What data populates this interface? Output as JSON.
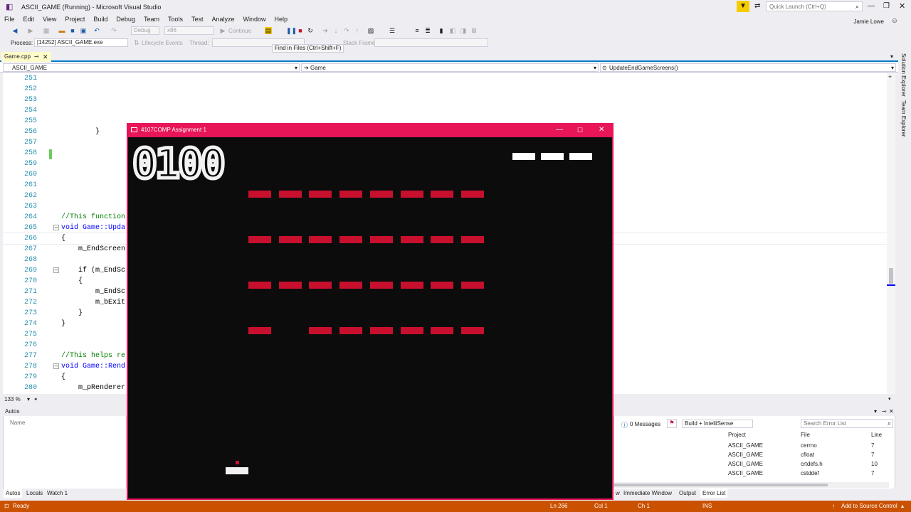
{
  "window": {
    "title": "ASCII_GAME (Running) - Microsoft Visual Studio",
    "quick_launch_placeholder": "Quick Launch (Ctrl+Q)",
    "user": "Jamie Lowe"
  },
  "menu": [
    "File",
    "Edit",
    "View",
    "Project",
    "Build",
    "Debug",
    "Team",
    "Tools",
    "Test",
    "Analyze",
    "Window",
    "Help"
  ],
  "toolbar": {
    "config": "Debug",
    "platform": "x86",
    "continue_label": "Continue",
    "process_label": "Process:",
    "process_value": "[14252] ASCII_GAME.exe",
    "lifecycle_label": "Lifecycle Events",
    "thread_label": "Thread:",
    "stack_frame_label": "Stack Frame:"
  },
  "tooltip": "Find in Files (Ctrl+Shift+F)",
  "doc_tab": "Game.cpp",
  "nav": {
    "project": "ASCII_GAME",
    "scope": "Game",
    "member": "UpdateEndGameScreens()"
  },
  "code_lines": [
    {
      "n": "251",
      "t": ""
    },
    {
      "n": "252",
      "t": ""
    },
    {
      "n": "253",
      "t": ""
    },
    {
      "n": "254",
      "t": ""
    },
    {
      "n": "255",
      "t": ""
    },
    {
      "n": "256",
      "t": "        }"
    },
    {
      "n": "257",
      "t": ""
    },
    {
      "n": "258",
      "t": ""
    },
    {
      "n": "259",
      "t": ""
    },
    {
      "n": "260",
      "t": ""
    },
    {
      "n": "261",
      "t": ""
    },
    {
      "n": "262",
      "t": ""
    },
    {
      "n": "263",
      "t": ""
    },
    {
      "n": "264",
      "t": "//This function"
    },
    {
      "n": "265",
      "t": "void Game::Upda"
    },
    {
      "n": "266",
      "t": "{"
    },
    {
      "n": "267",
      "t": "    m_EndScreen"
    },
    {
      "n": "268",
      "t": ""
    },
    {
      "n": "269",
      "t": "    if (m_EndSc"
    },
    {
      "n": "270",
      "t": "    {"
    },
    {
      "n": "271",
      "t": "        m_EndSc"
    },
    {
      "n": "272",
      "t": "        m_bExit"
    },
    {
      "n": "273",
      "t": "    }"
    },
    {
      "n": "274",
      "t": "}"
    },
    {
      "n": "275",
      "t": ""
    },
    {
      "n": "276",
      "t": ""
    },
    {
      "n": "277",
      "t": "//This helps re"
    },
    {
      "n": "278",
      "t": "void Game::Rend"
    },
    {
      "n": "279",
      "t": "{"
    },
    {
      "n": "280",
      "t": "    m_pRenderer"
    }
  ],
  "zoom": "133 %",
  "autos": {
    "title": "Autos",
    "name_col": "Name"
  },
  "error_list": {
    "messages": "0 Messages",
    "filter": "Build + IntelliSense",
    "search_placeholder": "Search Error List",
    "col_project": "Project",
    "col_file": "File",
    "col_line": "Line",
    "rows": [
      {
        "project": "ASCII_GAME",
        "file": "cerrno",
        "line": "7"
      },
      {
        "project": "ASCII_GAME",
        "file": "cfloat",
        "line": "7"
      },
      {
        "project": "ASCII_GAME",
        "file": "crtdefs.h",
        "line": "10"
      },
      {
        "project": "ASCII_GAME",
        "file": "cstddef",
        "line": "7"
      }
    ]
  },
  "bottom_tabs_left": [
    "Autos",
    "Locals",
    "Watch 1"
  ],
  "bottom_tabs_right": [
    "w",
    "Immediate Window",
    "Output",
    "Error List"
  ],
  "side_tabs": [
    "Solution Explorer",
    "Team Explorer"
  ],
  "status": {
    "ready": "Ready",
    "ln": "Ln 266",
    "col": "Col 1",
    "ch": "Ch 1",
    "ins": "INS",
    "source_control": "Add to Source Control"
  },
  "game": {
    "title": "4107COMP Assignment 1",
    "score": "0100",
    "lives": 3,
    "accent": "#e81558",
    "brick_color": "#c8102e",
    "brick_rows": [
      [
        1,
        1,
        1,
        1,
        1,
        1,
        1,
        1
      ],
      [
        1,
        1,
        1,
        1,
        1,
        1,
        1,
        1
      ],
      [
        1,
        1,
        1,
        1,
        1,
        1,
        1,
        1
      ],
      [
        1,
        0,
        1,
        1,
        1,
        1,
        1,
        1
      ]
    ]
  }
}
